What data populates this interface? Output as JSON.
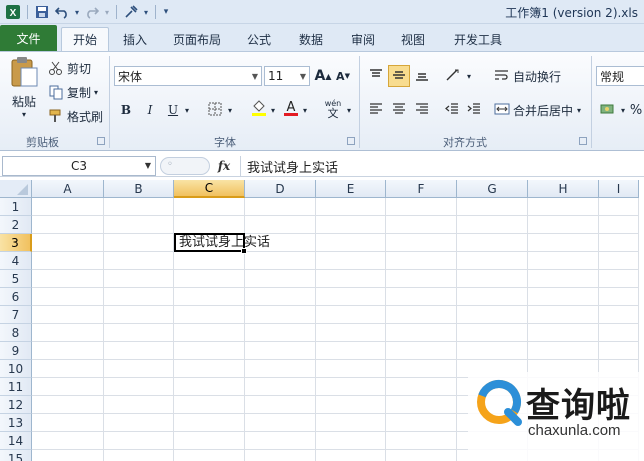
{
  "window": {
    "title": "工作簿1 (version 2).xls"
  },
  "tabs": {
    "file": "文件",
    "home": "开始",
    "insert": "插入",
    "page_layout": "页面布局",
    "formulas": "公式",
    "data": "数据",
    "review": "审阅",
    "view": "视图",
    "developer": "开发工具"
  },
  "ribbon": {
    "clipboard": {
      "label": "剪贴板",
      "paste": "粘贴",
      "cut": "剪切",
      "copy": "复制",
      "format_painter": "格式刷"
    },
    "font": {
      "label": "字体",
      "font_name": "宋体",
      "font_size": "11",
      "bold": "B",
      "italic": "I",
      "underline": "U",
      "grow": "A",
      "shrink": "A",
      "phonetic": "wén"
    },
    "alignment": {
      "label": "对齐方式",
      "wrap_text": "自动换行",
      "merge_center": "合并后居中"
    },
    "number": {
      "format": "常规",
      "percent": "%"
    }
  },
  "formula_bar": {
    "name_box": "C3",
    "fx": "fx",
    "content": "我试试身上实话"
  },
  "grid": {
    "columns": [
      "A",
      "B",
      "C",
      "D",
      "E",
      "F",
      "G",
      "H",
      "I"
    ],
    "rows": [
      "1",
      "2",
      "3",
      "4",
      "5",
      "6",
      "7",
      "8",
      "9",
      "10",
      "11",
      "12",
      "13",
      "14",
      "15"
    ],
    "selected_column": "C",
    "selected_row": "3",
    "cell_c3": "我试试身上实话"
  },
  "watermark": {
    "cn": "查询啦",
    "en": "chaxunla.com"
  },
  "colors": {
    "file_tab": "#2f7b36",
    "header_selected": "#f1c15f",
    "ribbon_bg": "#e6edf6"
  }
}
